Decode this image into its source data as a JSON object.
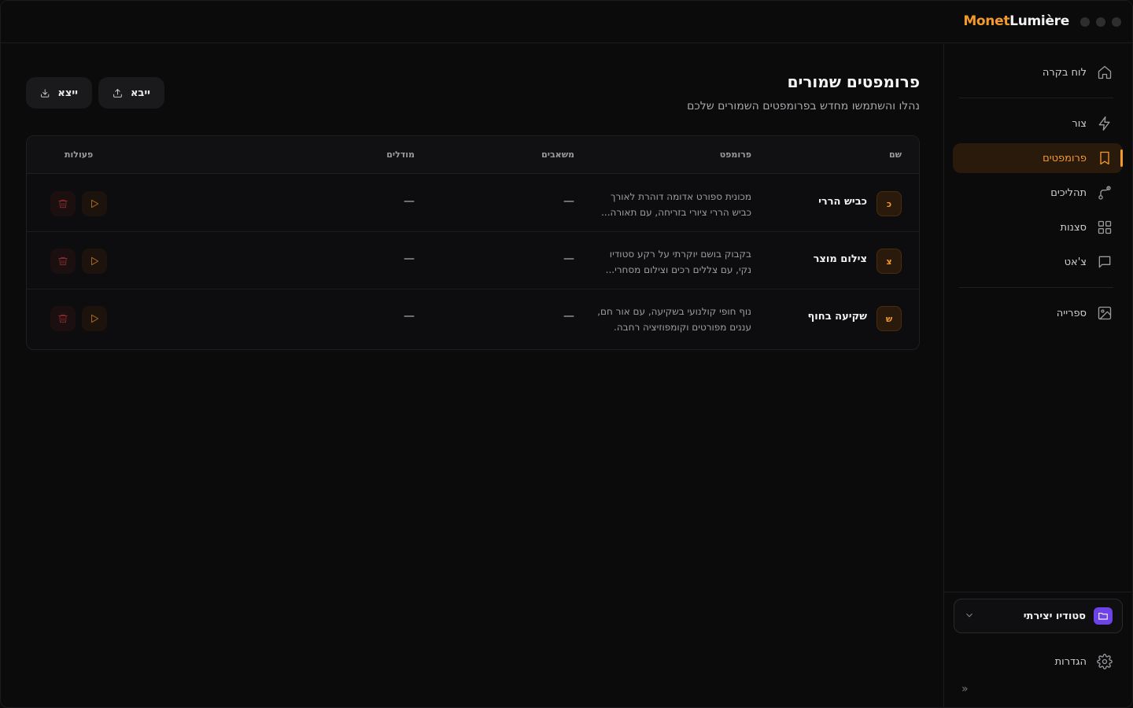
{
  "app": {
    "brand_part1": "Monet",
    "brand_part2": "Lumière"
  },
  "sidebar": {
    "items": [
      {
        "label": "לוח בקרה",
        "icon": "home-icon"
      },
      {
        "label": "צור",
        "icon": "lightning-icon"
      },
      {
        "label": "פרומפטים",
        "icon": "bookmark-icon",
        "active": true
      },
      {
        "label": "תהליכים",
        "icon": "workflow-icon"
      },
      {
        "label": "סצנות",
        "icon": "grid-icon"
      },
      {
        "label": "צ'אט",
        "icon": "chat-icon"
      },
      {
        "label": "ספרייה",
        "icon": "image-icon"
      }
    ],
    "workspace": {
      "label": "סטודיו יצירתי",
      "icon": "folder-icon"
    },
    "settings_label": "הגדרות",
    "collapse_glyph": "«"
  },
  "page": {
    "title": "פרומפטים שמורים",
    "subtitle": "נהלו והשתמשו מחדש בפרומפטים השמורים שלכם",
    "import_label": "ייבא",
    "export_label": "ייצא"
  },
  "table": {
    "headers": {
      "name": "שם",
      "prompt": "פרומפט",
      "assets": "משאבים",
      "models": "מודלים",
      "actions": "פעולות"
    },
    "rows": [
      {
        "initial": "כ",
        "name": "כביש הררי",
        "prompt_line1": "מכונית ספורט אדומה דוהרת לאורך",
        "prompt_line2": "כביש הררי ציורי בזריחה, עם תאורה...",
        "assets": "—",
        "models": "—"
      },
      {
        "initial": "צ",
        "name": "צילום מוצר",
        "prompt_line1": "בקבוק בושם יוקרתי על רקע סטודיו",
        "prompt_line2": "נקי, עם צללים רכים וצילום מסחרי...",
        "assets": "—",
        "models": "—"
      },
      {
        "initial": "ש",
        "name": "שקיעה בחוף",
        "prompt_line1": "נוף חופי קולנועי בשקיעה, עם אור חם,",
        "prompt_line2": "עננים מפורטים וקומפוזיציה רחבה.",
        "assets": "—",
        "models": "—"
      }
    ]
  },
  "colors": {
    "accent": "#f39a2b",
    "workspace_badge": "#6d43e8",
    "delete": "#8a2a2e"
  }
}
